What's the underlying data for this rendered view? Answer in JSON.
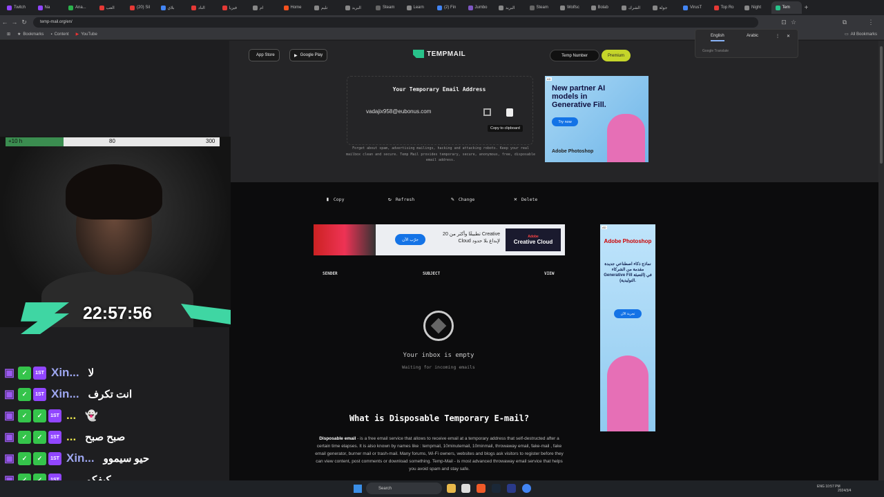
{
  "browser": {
    "tabs": [
      {
        "label": "Twitch",
        "color": "#9146ff"
      },
      {
        "label": "Na",
        "color": "#9146ff"
      },
      {
        "label": "Ana...",
        "color": "#2bb24c"
      },
      {
        "label": "العب",
        "color": "#e53935"
      },
      {
        "label": "(20) Sil",
        "color": "#e53935"
      },
      {
        "label": "بلاي",
        "color": "#4285f4"
      },
      {
        "label": "الناد",
        "color": "#e53935"
      },
      {
        "label": "فيزيا",
        "color": "#e53935"
      },
      {
        "label": "ام",
        "color": "#888"
      },
      {
        "label": "Home",
        "color": "#f4511e"
      },
      {
        "label": "تليم",
        "color": "#888"
      },
      {
        "label": "البريد",
        "color": "#888"
      },
      {
        "label": "Steam",
        "color": "#666"
      },
      {
        "label": "Learn",
        "color": "#888"
      },
      {
        "label": "(2) Fin",
        "color": "#4285f4"
      },
      {
        "label": "Jumbo",
        "color": "#7e57c2"
      },
      {
        "label": "البريد",
        "color": "#888"
      },
      {
        "label": "Steam",
        "color": "#666"
      },
      {
        "label": "Wolfsc",
        "color": "#888"
      },
      {
        "label": "Bolab",
        "color": "#888"
      },
      {
        "label": "الشرك",
        "color": "#888"
      },
      {
        "label": "جولة",
        "color": "#888"
      },
      {
        "label": "VirusT",
        "color": "#4285f4"
      },
      {
        "label": "Top Ro",
        "color": "#e53935"
      },
      {
        "label": "Night",
        "color": "#888"
      },
      {
        "label": "Tem",
        "color": "#28c28a",
        "active": true
      }
    ],
    "url": "temp-mail.org/en/",
    "bookmarks": [
      "Bookmarks",
      "Content",
      "YouTube"
    ],
    "all_bookmarks": "All Bookmarks",
    "translate": {
      "lang1": "English",
      "lang2": "Arabic",
      "hint": "Google Translate"
    }
  },
  "site": {
    "app_store": "App Store",
    "google_play": "Google Play",
    "logo": "TEMPMAIL",
    "temp_number": "Temp Number",
    "premium": "Premium",
    "email_title": "Your Temporary Email Address",
    "email": "vadajix958@eubonus.com",
    "tooltip": "Copy to clipboard",
    "description": "Forget about spam, advertising mailings, hacking and attacking robots. Keep your real mailbox clean and secure. Temp Mail provides temporary, secure, anonymous, free, disposable email address.",
    "actions": {
      "copy": "Copy",
      "refresh": "Refresh",
      "change": "Change",
      "delete": "Delete"
    },
    "columns": {
      "sender": "SENDER",
      "subject": "SUBJECT",
      "view": "VIEW"
    },
    "empty_title": "Your inbox is empty",
    "empty_sub": "Waiting for incoming emails",
    "what_is": "What is Disposable Temporary E-mail?",
    "para_bold": "Disposable email",
    "para": " - is a free email service that allows to receive email at a temporary address that self-destructed after a certain time elapses. It is also known by names like : tempmail, 10minutemail, 10minmail, throwaway email, fake-mail , fake email generator, burner mail or trash-mail. Many forums, Wi-Fi owners, websites and blogs ask visitors to register before they can view content, post comments or download something. Temp-Mail - is most advanced throwaway email service that helps you avoid spam and stay safe."
  },
  "ads": {
    "ad_tag": "AD",
    "ad1": {
      "headline": "New partner AI models in Generative Fill.",
      "button": "Try now",
      "brand": "Adobe Photoshop"
    },
    "ad2": {
      "cta": "جرّب الآن",
      "text": "20 تطبيقًا وأكثر من Creative Cloud لإبداع بلا حدود",
      "brand_small": "Adobe",
      "brand": "Creative Cloud"
    },
    "ad3": {
      "brand": "Adobe Photoshop",
      "text": "نماذج ذكاء اصطناعي جديدة مقدمة من الشركاء Generative Fill في (التعبئة التوليدية).",
      "button": "تجربة الآن"
    }
  },
  "stream": {
    "bar_left": "+10 h",
    "bar_mid": "80",
    "bar_right": "300",
    "bar_fill_fraction": 0.27,
    "clock": "22:57:56",
    "chat": [
      {
        "name": "Xin...",
        "msg": "لا",
        "badges": [
          "twitch",
          "green",
          "1st"
        ],
        "yellow": false
      },
      {
        "name": "Xin...",
        "msg": "انت تكرف",
        "badges": [
          "twitch",
          "green",
          "1st"
        ],
        "yellow": false
      },
      {
        "name": "...",
        "msg": "👻",
        "badges": [
          "twitch",
          "green",
          "green",
          "1st"
        ],
        "yellow": true
      },
      {
        "name": "...",
        "msg": "صبح صبح",
        "badges": [
          "twitch",
          "green",
          "green",
          "1st"
        ],
        "yellow": true
      },
      {
        "name": "Xin...",
        "msg": "حيو سيموو",
        "badges": [
          "twitch",
          "green",
          "green",
          "1st"
        ],
        "yellow": false
      },
      {
        "name": "...",
        "msg": "كيفكم",
        "badges": [
          "twitch",
          "green",
          "green",
          "1st"
        ],
        "yellow": true
      }
    ]
  },
  "taskbar": {
    "search": "Search",
    "lang": "ENG",
    "time": "10:57 PM",
    "date": "2024/3/4"
  }
}
